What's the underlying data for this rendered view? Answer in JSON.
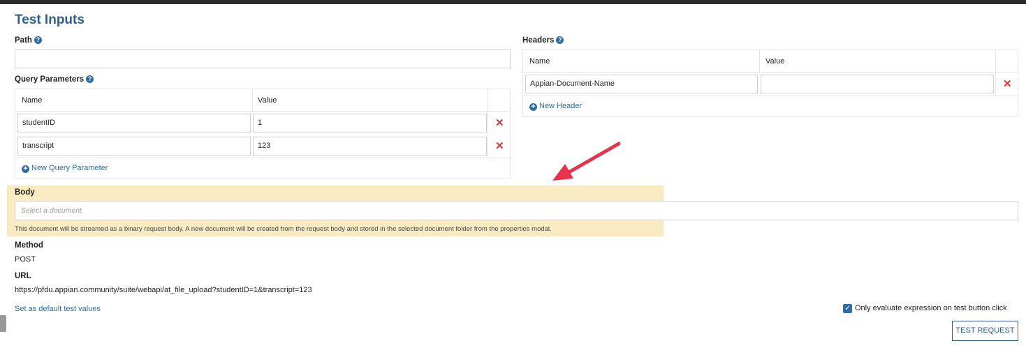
{
  "page": {
    "title": "Test Inputs",
    "help_glyph": "?",
    "delete_glyph": "✕",
    "add_glyph": "+",
    "check_glyph": "✓"
  },
  "path": {
    "label": "Path",
    "value": ""
  },
  "query_parameters": {
    "label": "Query Parameters",
    "columns": [
      "Name",
      "Value"
    ],
    "rows": [
      {
        "name": "studentID",
        "value": "1"
      },
      {
        "name": "transcript",
        "value": "123"
      }
    ],
    "add_label": "New Query Parameter"
  },
  "headers": {
    "label": "Headers",
    "columns": [
      "Name",
      "Value"
    ],
    "rows": [
      {
        "name": "Appian-Document-Name",
        "value": ""
      }
    ],
    "add_label": "New Header"
  },
  "body": {
    "label": "Body",
    "placeholder": "Select a document",
    "help_text": "This document will be streamed as a binary request body. A new document will be created from the request body and stored in the selected document folder from the properties modal."
  },
  "method": {
    "label": "Method",
    "value": "POST"
  },
  "url": {
    "label": "URL",
    "value": "https://pfdu.appian.community/suite/webapi/at_file_upload?studentID=1&transcript=123"
  },
  "footer": {
    "default_link": "Set as default test values",
    "checkbox_label": "Only evaluate expression on test button click",
    "checkbox_checked": true,
    "test_button": "TEST REQUEST"
  },
  "colors": {
    "accent": "#2d6da3",
    "title": "#2d5f8a",
    "delete": "#d0393b",
    "highlight": "#f9e7b3",
    "arrow": "#e8334a"
  }
}
